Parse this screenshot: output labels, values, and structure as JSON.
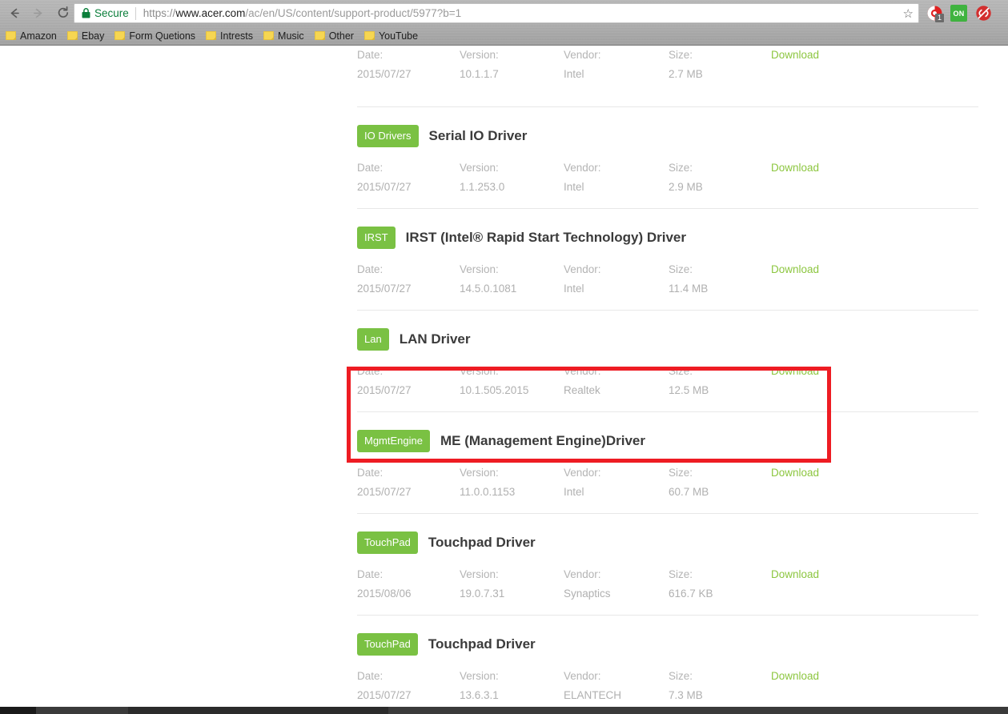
{
  "browser": {
    "back_label": "back-arrow",
    "forward_label": "forward-arrow",
    "reload_label": "reload",
    "security_label": "Secure",
    "url_scheme": "https://",
    "url_host": "www.acer.com",
    "url_path": "/ac/en/US/content/support-product/5977?b=1",
    "url_full": "https://www.acer.com/ac/en/US/content/support-product/5977?b=1",
    "star_glyph": "☆",
    "extensions": [
      {
        "name": "adblock-icon",
        "label": "",
        "badge": "1"
      },
      {
        "name": "extension-on-icon",
        "label": "ON",
        "badge": ""
      },
      {
        "name": "lastpass-icon",
        "label": "",
        "badge": ""
      }
    ],
    "bookmarks": [
      {
        "label": "Amazon"
      },
      {
        "label": "Ebay"
      },
      {
        "label": "Form Quetions"
      },
      {
        "label": "Intrests"
      },
      {
        "label": "Music"
      },
      {
        "label": "Other"
      },
      {
        "label": "YouTube"
      }
    ]
  },
  "colors": {
    "tag_green": "#7ac143",
    "download_green": "#8cc63f",
    "highlight_red": "#ee1c23",
    "secure_green": "#0b7f3b"
  },
  "labels": {
    "date": "Date:",
    "version": "Version:",
    "vendor": "Vendor:",
    "size": "Size:",
    "download": "Download"
  },
  "drivers": [
    {
      "tag": "",
      "title": "",
      "date": "2015/07/27",
      "version": "10.1.1.7",
      "vendor": "Intel",
      "size": "2.7 MB",
      "download": "Download",
      "highlighted": false,
      "partial": true
    },
    {
      "tag": "IO Drivers",
      "title": "Serial IO Driver",
      "date": "2015/07/27",
      "version": "1.1.253.0",
      "vendor": "Intel",
      "size": "2.9 MB",
      "download": "Download",
      "highlighted": false,
      "partial": false
    },
    {
      "tag": "IRST",
      "title": "IRST (Intel® Rapid Start Technology) Driver",
      "date": "2015/07/27",
      "version": "14.5.0.1081",
      "vendor": "Intel",
      "size": "11.4 MB",
      "download": "Download",
      "highlighted": false,
      "partial": false
    },
    {
      "tag": "Lan",
      "title": "LAN Driver",
      "date": "2015/07/27",
      "version": "10.1.505.2015",
      "vendor": "Realtek",
      "size": "12.5 MB",
      "download": "Download",
      "highlighted": true,
      "partial": false
    },
    {
      "tag": "MgmtEngine",
      "title": "ME (Management Engine)Driver",
      "date": "2015/07/27",
      "version": "11.0.0.1153",
      "vendor": "Intel",
      "size": "60.7 MB",
      "download": "Download",
      "highlighted": false,
      "partial": false
    },
    {
      "tag": "TouchPad",
      "title": "Touchpad Driver",
      "date": "2015/08/06",
      "version": "19.0.7.31",
      "vendor": "Synaptics",
      "size": "616.7 KB",
      "download": "Download",
      "highlighted": false,
      "partial": false
    },
    {
      "tag": "TouchPad",
      "title": "Touchpad Driver",
      "date": "2015/07/27",
      "version": "13.6.3.1",
      "vendor": "ELANTECH",
      "size": "7.3 MB",
      "download": "Download",
      "highlighted": false,
      "partial": false
    }
  ]
}
